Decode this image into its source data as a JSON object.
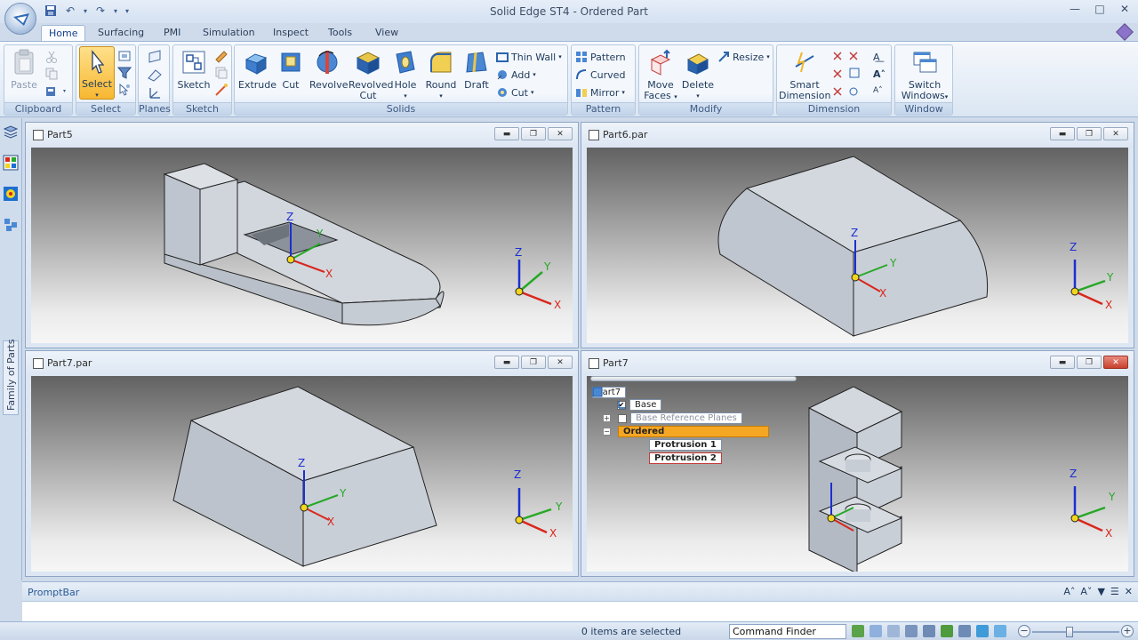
{
  "app": {
    "title": "Solid Edge ST4 - Ordered Part"
  },
  "ribbon": {
    "tabs": [
      "Home",
      "Surfacing",
      "PMI",
      "Simulation",
      "Inspect",
      "Tools",
      "View"
    ],
    "active_tab": "Home",
    "groups": {
      "clipboard": {
        "label": "Clipboard",
        "paste": "Paste"
      },
      "select": {
        "label": "Select",
        "select": "Select"
      },
      "planes": {
        "label": "Planes"
      },
      "sketch": {
        "label": "Sketch",
        "sketch": "Sketch"
      },
      "solids": {
        "label": "Solids",
        "extrude": "Extrude",
        "cut": "Cut",
        "revolve": "Revolve",
        "revolved_cut_1": "Revolved",
        "revolved_cut_2": "Cut",
        "hole": "Hole",
        "round": "Round",
        "draft": "Draft",
        "thin_wall": "Thin Wall",
        "add": "Add",
        "cut_small": "Cut"
      },
      "pattern": {
        "label": "Pattern",
        "pattern": "Pattern",
        "curved": "Curved",
        "mirror": "Mirror"
      },
      "modify": {
        "label": "Modify",
        "move_faces_1": "Move",
        "move_faces_2": "Faces",
        "delete": "Delete",
        "resize": "Resize"
      },
      "dimension": {
        "label": "Dimension",
        "smart_1": "Smart",
        "smart_2": "Dimension"
      },
      "window": {
        "label": "Window",
        "switch_1": "Switch",
        "switch_2": "Windows"
      }
    }
  },
  "sidebar": {
    "family_tab": "Family of Parts"
  },
  "documents": {
    "part5": {
      "name": "Part5"
    },
    "part6": {
      "name": "Part6.par"
    },
    "part7par": {
      "name": "Part7.par"
    },
    "part7": {
      "name": "Part7",
      "tree": {
        "root": "Part7",
        "base": "Base",
        "ref_planes": "Base Reference Planes",
        "ordered": "Ordered",
        "protrusion1": "Protrusion 1",
        "protrusion2": "Protrusion 2"
      }
    }
  },
  "axes": {
    "x": "X",
    "y": "Y",
    "z": "Z"
  },
  "promptbar": {
    "title": "PromptBar"
  },
  "status": {
    "selection": "0 items are selected",
    "command_finder": "Command Finder"
  },
  "colors": {
    "accent": "#15428b",
    "ordered_highlight": "#f5a623",
    "axis_x": "#d9261c",
    "axis_y": "#27a826",
    "axis_z": "#1c2fd1",
    "origin": "#f2d61b"
  }
}
